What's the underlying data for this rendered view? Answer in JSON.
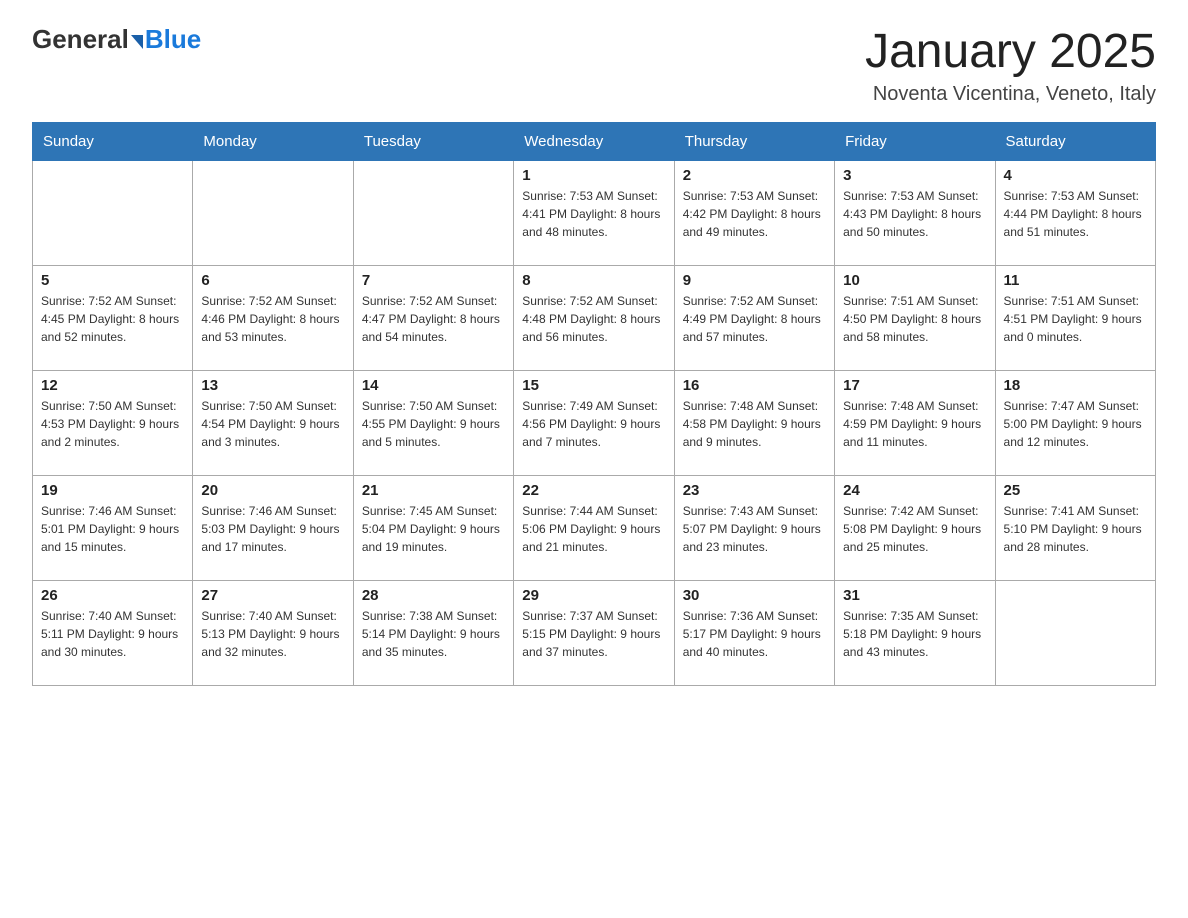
{
  "header": {
    "logo_general": "General",
    "logo_blue": "Blue",
    "title": "January 2025",
    "subtitle": "Noventa Vicentina, Veneto, Italy"
  },
  "weekdays": [
    "Sunday",
    "Monday",
    "Tuesday",
    "Wednesday",
    "Thursday",
    "Friday",
    "Saturday"
  ],
  "weeks": [
    [
      {
        "day": "",
        "info": ""
      },
      {
        "day": "",
        "info": ""
      },
      {
        "day": "",
        "info": ""
      },
      {
        "day": "1",
        "info": "Sunrise: 7:53 AM\nSunset: 4:41 PM\nDaylight: 8 hours\nand 48 minutes."
      },
      {
        "day": "2",
        "info": "Sunrise: 7:53 AM\nSunset: 4:42 PM\nDaylight: 8 hours\nand 49 minutes."
      },
      {
        "day": "3",
        "info": "Sunrise: 7:53 AM\nSunset: 4:43 PM\nDaylight: 8 hours\nand 50 minutes."
      },
      {
        "day": "4",
        "info": "Sunrise: 7:53 AM\nSunset: 4:44 PM\nDaylight: 8 hours\nand 51 minutes."
      }
    ],
    [
      {
        "day": "5",
        "info": "Sunrise: 7:52 AM\nSunset: 4:45 PM\nDaylight: 8 hours\nand 52 minutes."
      },
      {
        "day": "6",
        "info": "Sunrise: 7:52 AM\nSunset: 4:46 PM\nDaylight: 8 hours\nand 53 minutes."
      },
      {
        "day": "7",
        "info": "Sunrise: 7:52 AM\nSunset: 4:47 PM\nDaylight: 8 hours\nand 54 minutes."
      },
      {
        "day": "8",
        "info": "Sunrise: 7:52 AM\nSunset: 4:48 PM\nDaylight: 8 hours\nand 56 minutes."
      },
      {
        "day": "9",
        "info": "Sunrise: 7:52 AM\nSunset: 4:49 PM\nDaylight: 8 hours\nand 57 minutes."
      },
      {
        "day": "10",
        "info": "Sunrise: 7:51 AM\nSunset: 4:50 PM\nDaylight: 8 hours\nand 58 minutes."
      },
      {
        "day": "11",
        "info": "Sunrise: 7:51 AM\nSunset: 4:51 PM\nDaylight: 9 hours\nand 0 minutes."
      }
    ],
    [
      {
        "day": "12",
        "info": "Sunrise: 7:50 AM\nSunset: 4:53 PM\nDaylight: 9 hours\nand 2 minutes."
      },
      {
        "day": "13",
        "info": "Sunrise: 7:50 AM\nSunset: 4:54 PM\nDaylight: 9 hours\nand 3 minutes."
      },
      {
        "day": "14",
        "info": "Sunrise: 7:50 AM\nSunset: 4:55 PM\nDaylight: 9 hours\nand 5 minutes."
      },
      {
        "day": "15",
        "info": "Sunrise: 7:49 AM\nSunset: 4:56 PM\nDaylight: 9 hours\nand 7 minutes."
      },
      {
        "day": "16",
        "info": "Sunrise: 7:48 AM\nSunset: 4:58 PM\nDaylight: 9 hours\nand 9 minutes."
      },
      {
        "day": "17",
        "info": "Sunrise: 7:48 AM\nSunset: 4:59 PM\nDaylight: 9 hours\nand 11 minutes."
      },
      {
        "day": "18",
        "info": "Sunrise: 7:47 AM\nSunset: 5:00 PM\nDaylight: 9 hours\nand 12 minutes."
      }
    ],
    [
      {
        "day": "19",
        "info": "Sunrise: 7:46 AM\nSunset: 5:01 PM\nDaylight: 9 hours\nand 15 minutes."
      },
      {
        "day": "20",
        "info": "Sunrise: 7:46 AM\nSunset: 5:03 PM\nDaylight: 9 hours\nand 17 minutes."
      },
      {
        "day": "21",
        "info": "Sunrise: 7:45 AM\nSunset: 5:04 PM\nDaylight: 9 hours\nand 19 minutes."
      },
      {
        "day": "22",
        "info": "Sunrise: 7:44 AM\nSunset: 5:06 PM\nDaylight: 9 hours\nand 21 minutes."
      },
      {
        "day": "23",
        "info": "Sunrise: 7:43 AM\nSunset: 5:07 PM\nDaylight: 9 hours\nand 23 minutes."
      },
      {
        "day": "24",
        "info": "Sunrise: 7:42 AM\nSunset: 5:08 PM\nDaylight: 9 hours\nand 25 minutes."
      },
      {
        "day": "25",
        "info": "Sunrise: 7:41 AM\nSunset: 5:10 PM\nDaylight: 9 hours\nand 28 minutes."
      }
    ],
    [
      {
        "day": "26",
        "info": "Sunrise: 7:40 AM\nSunset: 5:11 PM\nDaylight: 9 hours\nand 30 minutes."
      },
      {
        "day": "27",
        "info": "Sunrise: 7:40 AM\nSunset: 5:13 PM\nDaylight: 9 hours\nand 32 minutes."
      },
      {
        "day": "28",
        "info": "Sunrise: 7:38 AM\nSunset: 5:14 PM\nDaylight: 9 hours\nand 35 minutes."
      },
      {
        "day": "29",
        "info": "Sunrise: 7:37 AM\nSunset: 5:15 PM\nDaylight: 9 hours\nand 37 minutes."
      },
      {
        "day": "30",
        "info": "Sunrise: 7:36 AM\nSunset: 5:17 PM\nDaylight: 9 hours\nand 40 minutes."
      },
      {
        "day": "31",
        "info": "Sunrise: 7:35 AM\nSunset: 5:18 PM\nDaylight: 9 hours\nand 43 minutes."
      },
      {
        "day": "",
        "info": ""
      }
    ]
  ]
}
